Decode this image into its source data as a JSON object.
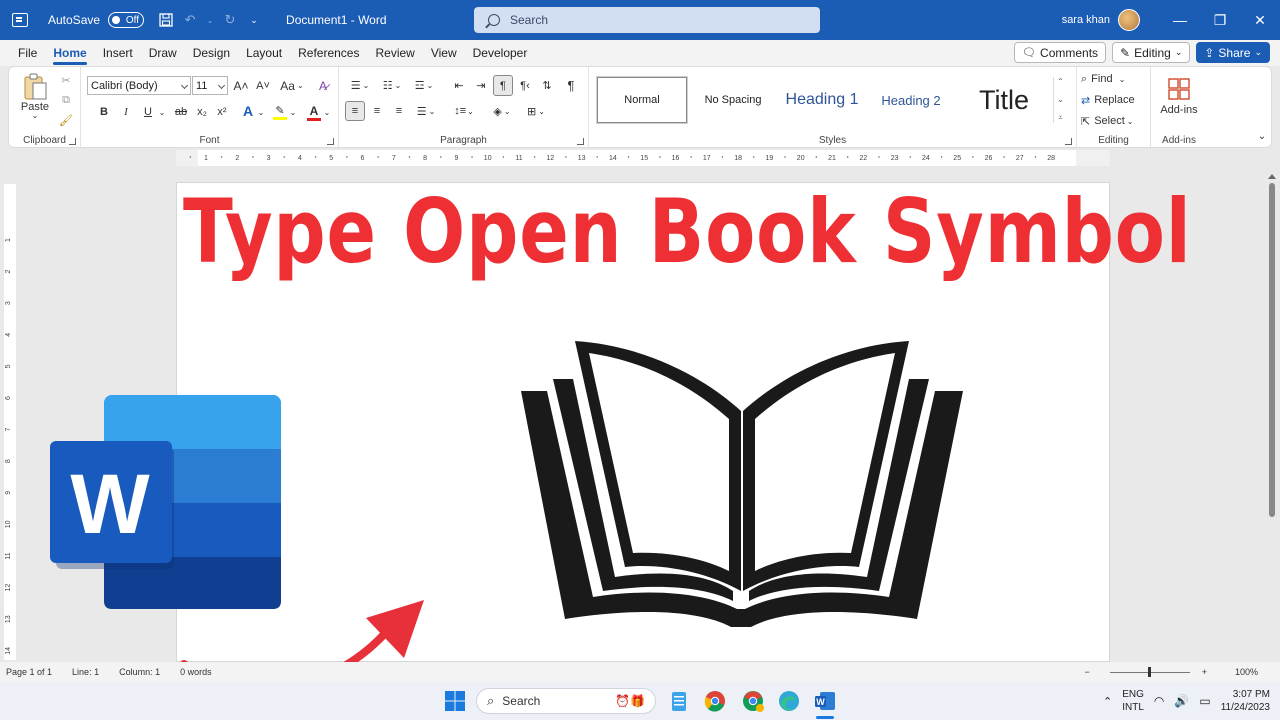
{
  "titlebar": {
    "autosave_label": "AutoSave",
    "autosave_state": "Off",
    "doc_title": "Document1  -  Word",
    "search_placeholder": "Search",
    "user_name": "sara khan"
  },
  "tabs": [
    "File",
    "Home",
    "Insert",
    "Draw",
    "Design",
    "Layout",
    "References",
    "Review",
    "View",
    "Developer"
  ],
  "active_tab": "Home",
  "tab_actions": {
    "comments": "Comments",
    "editing": "Editing",
    "share": "Share"
  },
  "ribbon": {
    "clipboard": {
      "label": "Clipboard",
      "paste": "Paste"
    },
    "font": {
      "label": "Font",
      "font_name": "Calibri (Body)",
      "font_size": "11",
      "grow": "A˄",
      "shrink": "A˅",
      "case": "Aa",
      "bold": "B",
      "italic": "I",
      "underline": "U",
      "strike": "ab",
      "subscript": "x₂",
      "superscript": "x²"
    },
    "paragraph": {
      "label": "Paragraph"
    },
    "styles": {
      "label": "Styles",
      "items": [
        "Normal",
        "No Spacing",
        "Heading 1",
        "Heading 2",
        "Title"
      ]
    },
    "editing": {
      "label": "Editing",
      "find": "Find",
      "replace": "Replace",
      "select": "Select"
    },
    "addins": {
      "label": "Add-ins",
      "button": "Add-ins"
    }
  },
  "ruler_marks": [
    "1",
    "2",
    "3",
    "4",
    "5",
    "6",
    "7",
    "8",
    "9",
    "10",
    "11",
    "12",
    "13",
    "14",
    "15",
    "16",
    "17",
    "18",
    "19",
    "20",
    "21",
    "22",
    "23",
    "24",
    "25",
    "26",
    "27",
    "28"
  ],
  "ruler_v_marks": [
    "1",
    "2",
    "3",
    "4",
    "5",
    "6",
    "7",
    "8",
    "9",
    "10",
    "11",
    "12",
    "13",
    "14"
  ],
  "document": {
    "headline": "Type Open Book Symbol"
  },
  "statusbar": {
    "page": "Page 1 of 1",
    "line": "Line: 1",
    "column": "Column: 1",
    "words": "0 words",
    "zoom": "100%"
  },
  "taskbar": {
    "search": "Search",
    "lang_top": "ENG",
    "lang_bottom": "INTL",
    "time": "3:07 PM",
    "date": "11/24/2023"
  },
  "colors": {
    "word_blue": "#1b5cb5",
    "headline_red": "#ee2f34",
    "arrow_red": "#e8303a"
  }
}
